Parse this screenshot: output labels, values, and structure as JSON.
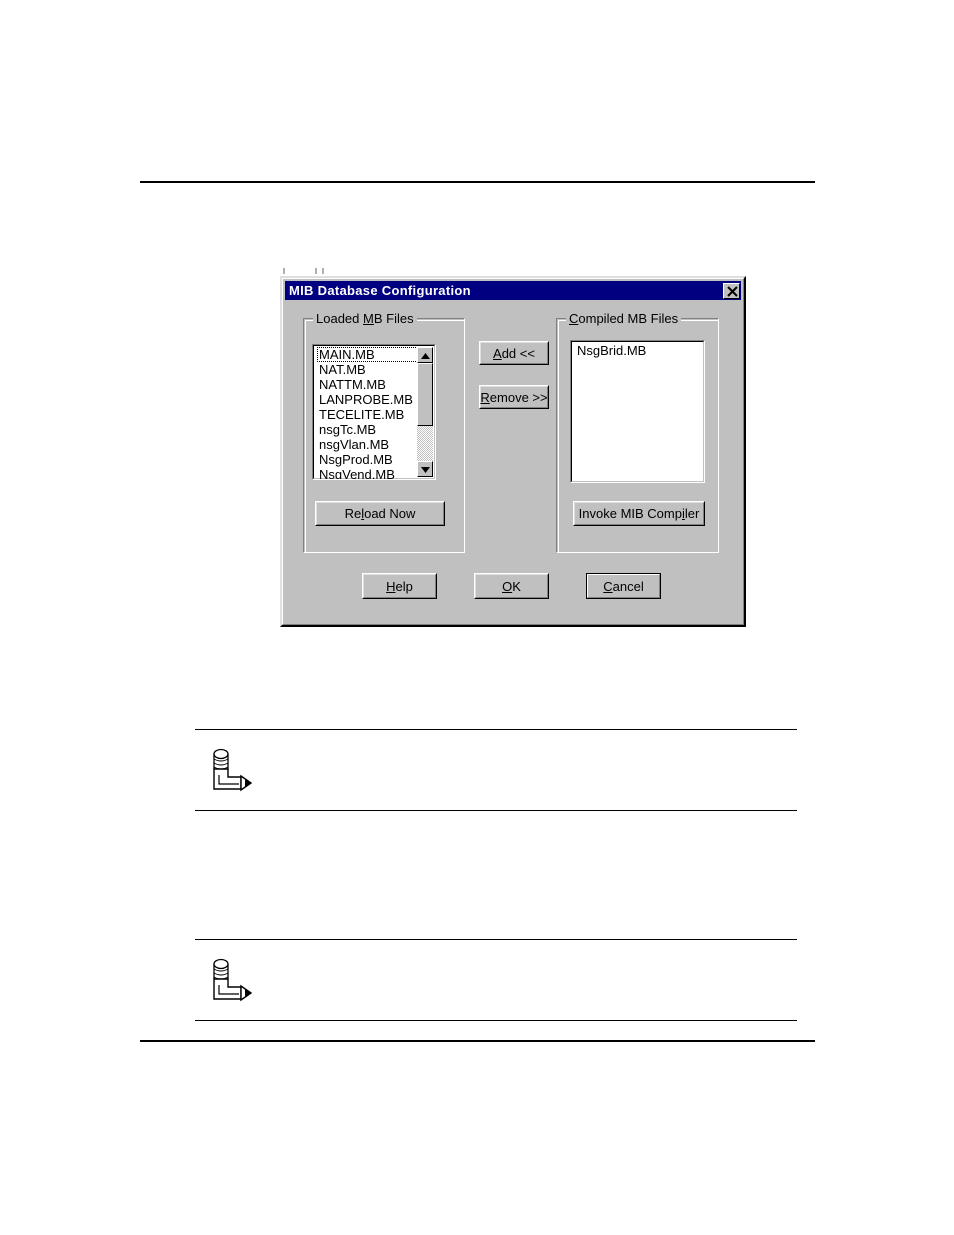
{
  "page": {
    "background": "#ffffff",
    "rules": [
      "top-rule",
      "bottom-rule"
    ]
  },
  "notes": [
    {
      "icon": "pencil-note-icon",
      "text": ""
    },
    {
      "icon": "pencil-note-icon",
      "text": ""
    }
  ],
  "dialog": {
    "title": "MIB Database Configuration",
    "title_bar_color": "#000080",
    "title_text_color": "#ffffff",
    "face_color": "#c0c0c0",
    "close_button_label": "×",
    "groups": {
      "loaded": {
        "label_before": "Loaded ",
        "label_accel": "M",
        "label_after": "B Files",
        "items": [
          "MAIN.MB",
          "NAT.MB",
          "NATTM.MB",
          "LANPROBE.MB",
          "TECELITE.MB",
          "nsgTc.MB",
          "nsgVlan.MB",
          "NsgProd.MB",
          "NsgVend.MB"
        ],
        "focused_item": "MAIN.MB",
        "button": {
          "before": "Re",
          "accel": "l",
          "after": "oad Now"
        }
      },
      "compiled": {
        "label_accel": "C",
        "label_after": "ompiled MB Files",
        "items": [
          "NsgBrid.MB"
        ],
        "button": {
          "before": "Invoke MIB Comp",
          "accel": "i",
          "after": "ler"
        }
      }
    },
    "transfer_buttons": [
      {
        "before": "",
        "accel": "A",
        "after": "dd <<"
      },
      {
        "before": "",
        "accel": "R",
        "after": "emove >>"
      }
    ],
    "action_buttons": [
      {
        "before": "",
        "accel": "H",
        "after": "elp",
        "default": false
      },
      {
        "before": "",
        "accel": "O",
        "after": "K",
        "default": false
      },
      {
        "before": "",
        "accel": "C",
        "after": "ancel",
        "default": true
      }
    ]
  }
}
